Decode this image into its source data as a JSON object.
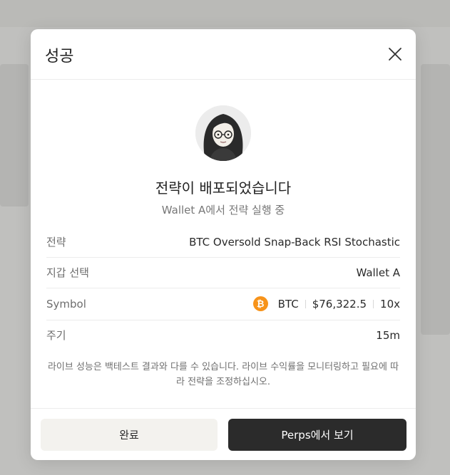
{
  "modal": {
    "title": "성공",
    "headline": "전략이 배포되었습니다",
    "subline": "Wallet A에서 전략 실행 중",
    "rows": [
      {
        "label": "전략",
        "value": "BTC Oversold Snap-Back RSI Stochastic"
      },
      {
        "label": "지갑 선택",
        "value": "Wallet A"
      },
      {
        "label": "Symbol",
        "symbol": "BTC",
        "price": "$76,322.5",
        "leverage": "10x",
        "icon": "bitcoin-icon",
        "icon_glyph": "₿"
      },
      {
        "label": "주기",
        "value": "15m"
      }
    ],
    "notice": "라이브 성능은 백테스트 결과와 다를 수 있습니다. 라이브 수익률을 모니터링하고 필요에 따라 전략을 조정하십시오.",
    "buttons": {
      "done": "완료",
      "view_perps": "Perps에서 보기"
    }
  },
  "colors": {
    "primary_button": "#2b2b2b",
    "secondary_button": "#f3f2ee",
    "bitcoin": "#f7931a"
  }
}
